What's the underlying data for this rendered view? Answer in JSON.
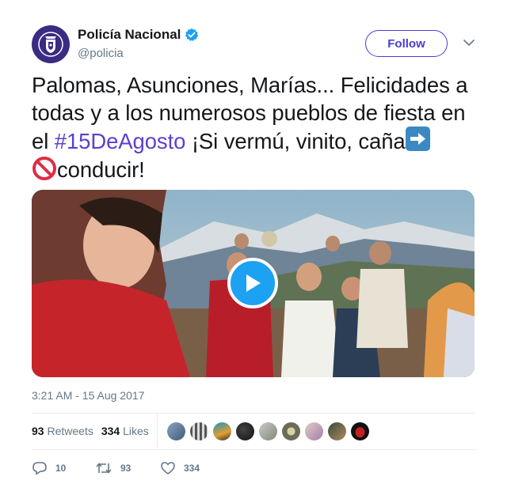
{
  "account": {
    "name": "Policía Nacional",
    "handle": "@policia",
    "verified": true,
    "avatar_color": "#3b2b82"
  },
  "follow_label": "Follow",
  "tweet": {
    "text_before": "Palomas, Asunciones, Marías... Felicidades a todas y a los numerosos pueblos de fiesta en el ",
    "hashtag": "#15DeAgosto",
    "text_after": "  ¡Si vermú, vinito, caña",
    "text_end": "conducir!",
    "emoji_1": "right-arrow-emoji",
    "emoji_2": "prohibited-emoji",
    "hashtag_color": "#5b3fd1"
  },
  "media": {
    "type": "video",
    "play_icon": "play-icon"
  },
  "timestamp": "3:21 AM - 15 Aug 2017",
  "stats": {
    "retweets_count": "93",
    "retweets_label": "Retweets",
    "likes_count": "334",
    "likes_label": "Likes"
  },
  "actions": {
    "replies": "10",
    "retweets": "93",
    "likes": "334"
  },
  "colors": {
    "accent": "#1da1f2",
    "follow_border": "#4a3bd6",
    "muted_text": "#657786"
  }
}
